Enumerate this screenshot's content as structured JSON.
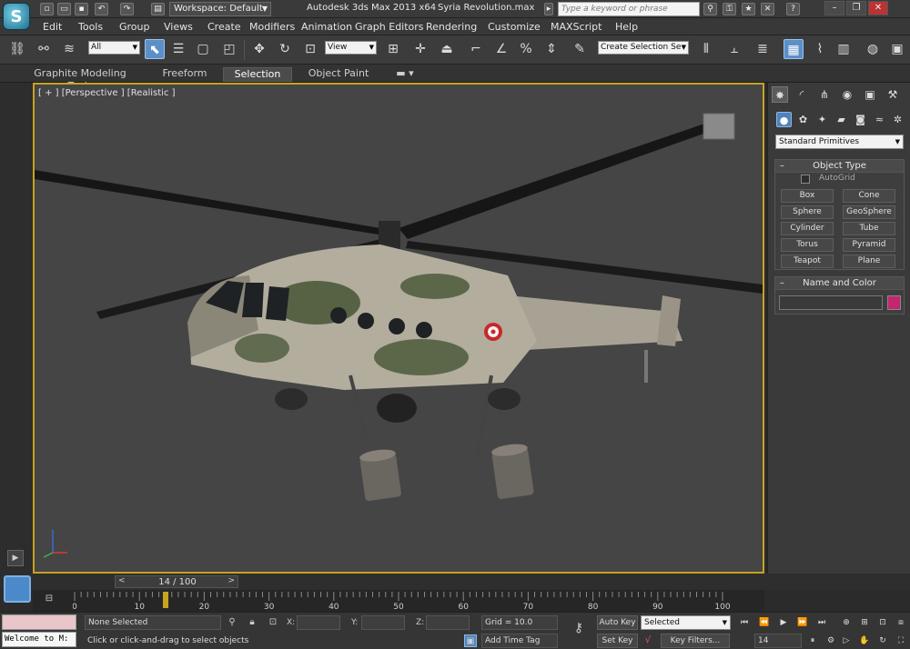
{
  "app": {
    "workspace": "Workspace: Default",
    "title": "Autodesk 3ds Max  2013 x64",
    "file": "Syria Revolution.max",
    "search_placeholder": "Type a keyword or phrase"
  },
  "menu": [
    "Edit",
    "Tools",
    "Group",
    "Views",
    "Create",
    "Modifiers",
    "Animation",
    "Graph Editors",
    "Rendering",
    "Customize",
    "MAXScript",
    "Help"
  ],
  "toolbar": {
    "filter": "All",
    "ref_coord": "View",
    "named_selection": "Create Selection Se"
  },
  "ribbon": [
    "Graphite Modeling Tools",
    "Freeform",
    "Selection",
    "Object Paint"
  ],
  "viewport": {
    "label": "[ + ] [Perspective ] [Realistic ]"
  },
  "command_panel": {
    "category": "Standard Primitives",
    "object_type_title": "Object Type",
    "autogrid": "AutoGrid",
    "primitives": [
      "Box",
      "Cone",
      "Sphere",
      "GeoSphere",
      "Cylinder",
      "Tube",
      "Torus",
      "Pyramid",
      "Teapot",
      "Plane"
    ],
    "name_color_title": "Name and Color",
    "swatch_color": "#c2266e"
  },
  "timeline": {
    "slider_label": "14 / 100",
    "ticks": [
      "0",
      "10",
      "20",
      "30",
      "40",
      "50",
      "60",
      "70",
      "80",
      "90",
      "100"
    ],
    "current_frame": 14
  },
  "status": {
    "welcome": "Welcome to M:",
    "selection": "None Selected",
    "prompt": "Click or click-and-drag to select objects",
    "x_label": "X:",
    "y_label": "Y:",
    "z_label": "Z:",
    "grid": "Grid = 10.0",
    "add_time_tag": "Add Time Tag",
    "auto_key": "Auto Key",
    "set_key": "Set Key",
    "key_mode": "Selected",
    "key_filters": "Key Filters...",
    "frame": "14"
  }
}
